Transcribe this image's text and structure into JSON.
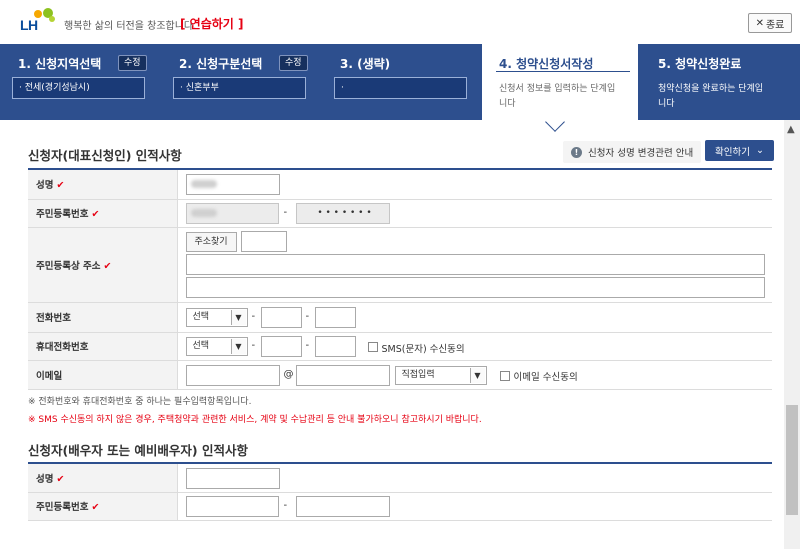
{
  "header": {
    "logo_text": "LH",
    "slogan": "행복한 삶의 터전을 창조합니다.",
    "practice_label": "[ 연습하기 ]",
    "close_label": "종료",
    "close_icon": "close-icon"
  },
  "steps": [
    {
      "title": "1. 신청지역선택",
      "edit": "수정",
      "value": "전세(경기성남시)"
    },
    {
      "title": "2. 신청구분선택",
      "edit": "수정",
      "value": "신혼부부"
    },
    {
      "title": "3. (생략)",
      "value": ""
    },
    {
      "title": "4. 청약신청서작성",
      "desc": "신청서 정보를 입력하는 단계입니다"
    },
    {
      "title": "5. 청약신청완료",
      "desc": "청약신청을 완료하는 단계입니다"
    }
  ],
  "applicant": {
    "title": "신청자(대표신청인) 인적사항",
    "info_link": "신청자 성명 변경관련 안내",
    "confirm_label": "확인하기",
    "labels": {
      "name": "성명",
      "rrn": "주민등록번호",
      "address": "주민등록상 주소",
      "phone": "전화번호",
      "mobile": "휴대전화번호",
      "email": "이메일"
    },
    "rrn_back": "• • • • • • •",
    "address_button": "주소찾기",
    "phone_select": "선택",
    "mobile_select": "선택",
    "sms_consent": "SMS(문자) 수신동의",
    "email_at": "@",
    "email_domain": "직접입력",
    "email_consent": "이메일 수신동의",
    "dash": "-"
  },
  "notes": {
    "required": "※ 전화번호와 휴대전화번호 중 하나는 필수입력항목입니다.",
    "sms_warning": "※ SMS 수신동의 하지 않은 경우, 주택청약과 관련한 서비스, 계약 및 수납관리 등 안내 불가하오니 참고하시기 바랍니다."
  },
  "spouse": {
    "title": "신청자(배우자 또는 예비배우자) 인적사항",
    "labels": {
      "name": "성명",
      "rrn": "주민등록번호"
    }
  },
  "colors": {
    "primary": "#2d4f8e",
    "required_mark": "#e60012"
  }
}
